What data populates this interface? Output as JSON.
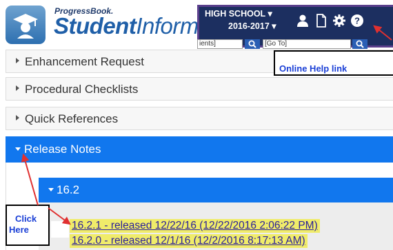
{
  "brand": {
    "small": "ProgressBook.",
    "bold": "Student",
    "light": "Informa"
  },
  "topbar": {
    "school": "HIGH SCHOOL ▾",
    "year": "2016-2017 ▾",
    "icons": [
      "user-icon",
      "document-icon",
      "gear-icon",
      "help-icon"
    ],
    "student_search_value": "ients]",
    "goto_value": "[Go To]"
  },
  "callouts": {
    "help": "Online Help link",
    "click_line1": "Click",
    "click_line2": "Here"
  },
  "accordion": [
    {
      "label": "Enhancement Request"
    },
    {
      "label": "Procedural Checklists"
    },
    {
      "label": "Quick References"
    },
    {
      "label": "Release Notes"
    }
  ],
  "release_notes": {
    "version": "16.2",
    "links": [
      "16.2.1 - released 12/22/16 (12/22/2016 2:06:22 PM)",
      "16.2.0 - released 12/1/16 (12/2/2016 8:17:13 AM)"
    ]
  },
  "colors": {
    "accent_blue": "#1177ee",
    "navy": "#1c2f60",
    "highlight": "#f0ec6a",
    "callout_text": "#1a3fd6",
    "arrow_red": "#e03030"
  }
}
